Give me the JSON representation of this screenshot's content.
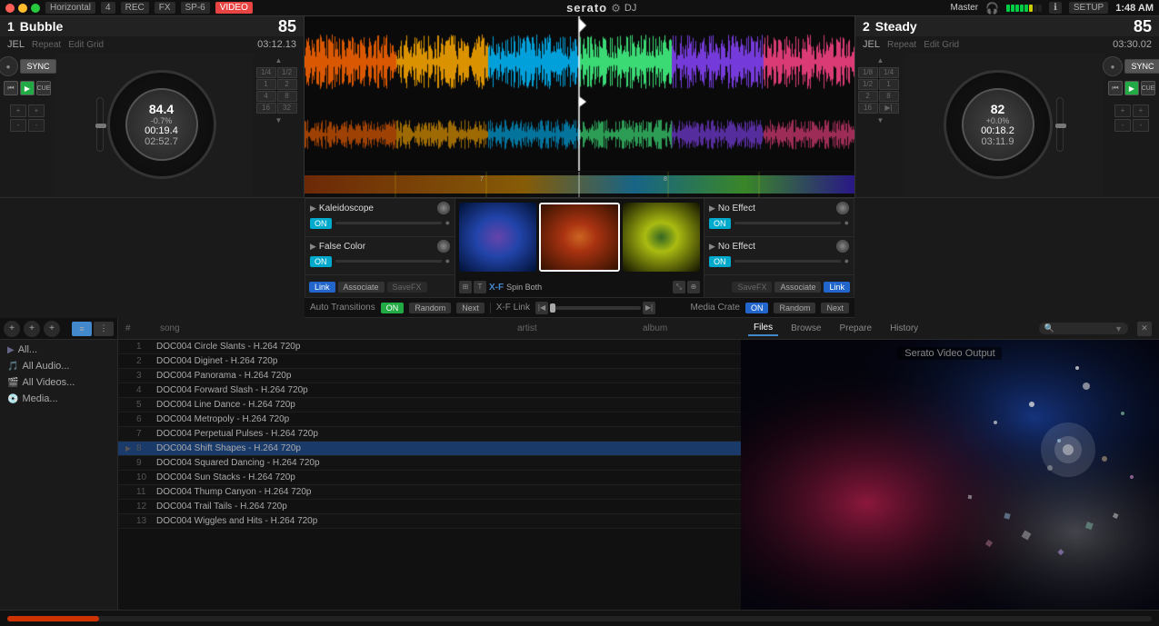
{
  "topbar": {
    "buttons": [
      "Horizontal",
      "4",
      "REC",
      "FX",
      "SP-6",
      "VIDEO"
    ],
    "logo": "serato",
    "dj": "DJ",
    "master_label": "Master",
    "setup_label": "SETUP",
    "time": "1:48 AM"
  },
  "deck_left": {
    "number": "1",
    "title": "Bubble",
    "artist": "JEL",
    "bpm": "85",
    "repeat_label": "Repeat",
    "edit_grid_label": "Edit Grid",
    "time_display": "03:12.13",
    "platter_bpm": "84.4",
    "platter_pitch": "-0.7%",
    "platter_time1": "00:19.4",
    "platter_time2": "02:52.7",
    "sync_label": "SYNC"
  },
  "deck_right": {
    "number": "2",
    "title": "Steady",
    "artist": "JEL",
    "bpm": "85",
    "repeat_label": "Repeat",
    "edit_grid_label": "Edit Grid",
    "time_display": "03:30.02",
    "platter_bpm": "82",
    "platter_pitch": "+0.0%",
    "platter_time1": "00:18.2",
    "platter_time2": "03:11.9",
    "sync_label": "SYNC"
  },
  "effects": {
    "fx1_name": "Kaleidoscope",
    "fx1_on": "ON",
    "fx2_name": "False Color",
    "fx2_on": "ON",
    "fx3_name": "No Effect",
    "fx3_on": "ON",
    "fx4_name": "No Effect",
    "fx4_on": "ON",
    "link_label": "Link",
    "associate_label": "Associate",
    "savefx_label": "SaveFX",
    "xf_label": "X-F",
    "spin_label": "Spin Both"
  },
  "transitions": {
    "auto_transitions_label": "Auto Transitions",
    "on_label": "ON",
    "random_label": "Random",
    "next_label": "Next",
    "xf_link_label": "X-F Link",
    "media_crate_label": "Media Crate",
    "random_label2": "Random",
    "next_label2": "Next"
  },
  "library": {
    "items": [
      {
        "label": "All..."
      },
      {
        "label": "All Audio..."
      },
      {
        "label": "All Videos..."
      },
      {
        "label": "Media..."
      }
    ]
  },
  "tracklist": {
    "columns": [
      "#",
      "song",
      "artist",
      "album"
    ],
    "tracks": [
      {
        "num": "1",
        "title": "DOC004 Circle Slants - H.264 720p",
        "artist": "",
        "album": ""
      },
      {
        "num": "2",
        "title": "DOC004 Diginet - H.264 720p",
        "artist": "",
        "album": ""
      },
      {
        "num": "3",
        "title": "DOC004 Panorama - H.264 720p",
        "artist": "",
        "album": ""
      },
      {
        "num": "4",
        "title": "DOC004 Forward Slash - H.264 720p",
        "artist": "",
        "album": ""
      },
      {
        "num": "5",
        "title": "DOC004 Line Dance - H.264 720p",
        "artist": "",
        "album": ""
      },
      {
        "num": "6",
        "title": "DOC004 Metropoly - H.264 720p",
        "artist": "",
        "album": ""
      },
      {
        "num": "7",
        "title": "DOC004 Perpetual Pulses - H.264 720p",
        "artist": "",
        "album": ""
      },
      {
        "num": "8",
        "title": "DOC004 Shift Shapes - H.264 720p",
        "artist": "",
        "album": "",
        "selected": true
      },
      {
        "num": "9",
        "title": "DOC004 Squared Dancing - H.264 720p",
        "artist": "",
        "album": ""
      },
      {
        "num": "10",
        "title": "DOC004 Sun Stacks - H.264 720p",
        "artist": "",
        "album": ""
      },
      {
        "num": "11",
        "title": "DOC004 Thump Canyon - H.264 720p",
        "artist": "",
        "album": ""
      },
      {
        "num": "12",
        "title": "DOC004 Trail Tails - H.264 720p",
        "artist": "",
        "album": ""
      },
      {
        "num": "13",
        "title": "DOC004 Wiggles and Hits - H.264 720p",
        "artist": "",
        "album": ""
      }
    ]
  },
  "right_panel": {
    "tabs": [
      "Files",
      "Browse",
      "Prepare",
      "History"
    ],
    "search_placeholder": "🔍",
    "video_output_label": "Serato Video Output"
  }
}
